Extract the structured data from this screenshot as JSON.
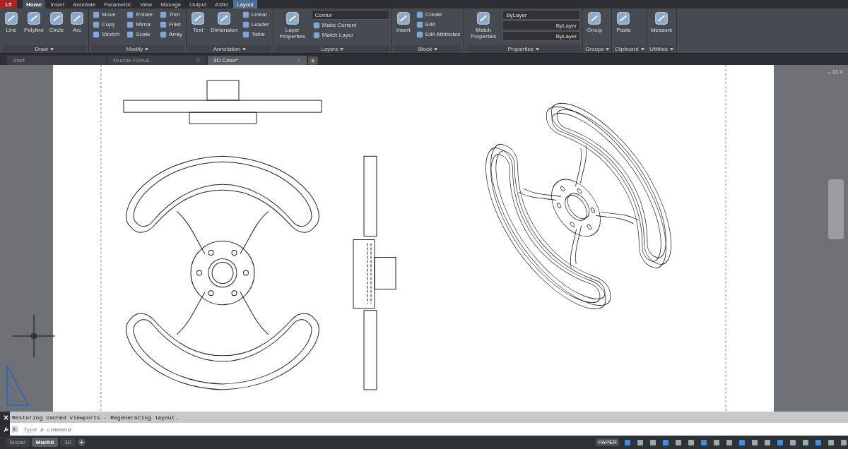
{
  "app_button": {
    "label": "LT"
  },
  "ribbon_tabs": [
    {
      "label": "Home",
      "selected": true,
      "contextual": false
    },
    {
      "label": "Insert",
      "selected": false,
      "contextual": false
    },
    {
      "label": "Annotate",
      "selected": false,
      "contextual": false
    },
    {
      "label": "Parametric",
      "selected": false,
      "contextual": false
    },
    {
      "label": "View",
      "selected": false,
      "contextual": false
    },
    {
      "label": "Manage",
      "selected": false,
      "contextual": false
    },
    {
      "label": "Output",
      "selected": false,
      "contextual": false
    },
    {
      "label": "A360",
      "selected": false,
      "contextual": false
    },
    {
      "label": "Layout",
      "selected": false,
      "contextual": true
    }
  ],
  "panels": [
    {
      "title": "Draw",
      "large": [
        "Line",
        "Polyline",
        "Circle",
        "Arc"
      ]
    },
    {
      "title": "Modify",
      "small": [
        "Move",
        "Copy",
        "Stretch",
        "Rotate",
        "Mirror",
        "Scale",
        "Trim",
        "Fillet",
        "Array"
      ]
    },
    {
      "title": "Annotation",
      "large": [
        "Text",
        "Dimension"
      ],
      "small": [
        "Linear",
        "Leader",
        "Table"
      ]
    },
    {
      "title": "Layers",
      "large": [
        "Layer Properties"
      ],
      "combos": [
        "Contur"
      ],
      "small": [
        "Make Current",
        "Match Layer"
      ]
    },
    {
      "title": "Block",
      "large": [
        "Insert"
      ],
      "small": [
        "Create",
        "Edit",
        "Edit Attributes"
      ]
    },
    {
      "title": "Properties",
      "large": [
        "Match Properties"
      ],
      "combos": [
        "ByLayer",
        "ByLayer",
        "ByLayer"
      ]
    },
    {
      "title": "Groups",
      "large": [
        "Group"
      ]
    },
    {
      "title": "Clipboard",
      "large": [
        "Paste"
      ]
    },
    {
      "title": "Utilities",
      "large": [
        "Measure"
      ]
    }
  ],
  "file_tabs": [
    {
      "label": "Start",
      "selected": false,
      "closable": false
    },
    {
      "label": "Muchie Fictiva",
      "selected": false,
      "closable": true
    },
    {
      "label": "3D Color*",
      "selected": true,
      "closable": true
    }
  ],
  "command_line": {
    "history": "Restoring cached viewports - Regenerating layout.",
    "placeholder": "Type a command"
  },
  "layout_tabs": [
    {
      "label": "Model",
      "selected": false
    },
    {
      "label": "Muchii",
      "selected": true
    },
    {
      "label": "3D",
      "selected": false
    }
  ],
  "status_bar": {
    "space": "PAPER"
  }
}
